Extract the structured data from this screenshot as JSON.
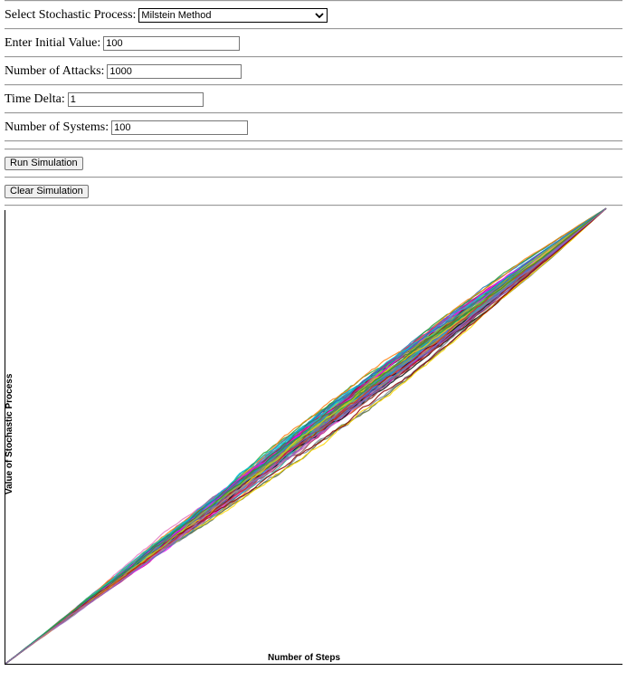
{
  "form": {
    "process_label": "Select Stochastic Process:",
    "process_value": "Milstein Method",
    "initial_label": "Enter Initial Value:",
    "initial_value": "100",
    "attacks_label": "Number of Attacks:",
    "attacks_value": "1000",
    "delta_label": "Time Delta:",
    "delta_value": "1",
    "systems_label": "Number of Systems:",
    "systems_value": "100",
    "run_label": "Run Simulation",
    "clear_label": "Clear Simulation"
  },
  "chart_data": {
    "type": "line",
    "xlabel": "Number of Steps",
    "ylabel": "Value of Stochastic Process",
    "n_series": 100,
    "steps": 1000,
    "initial_value": 100,
    "grid": false,
    "legend": false
  }
}
